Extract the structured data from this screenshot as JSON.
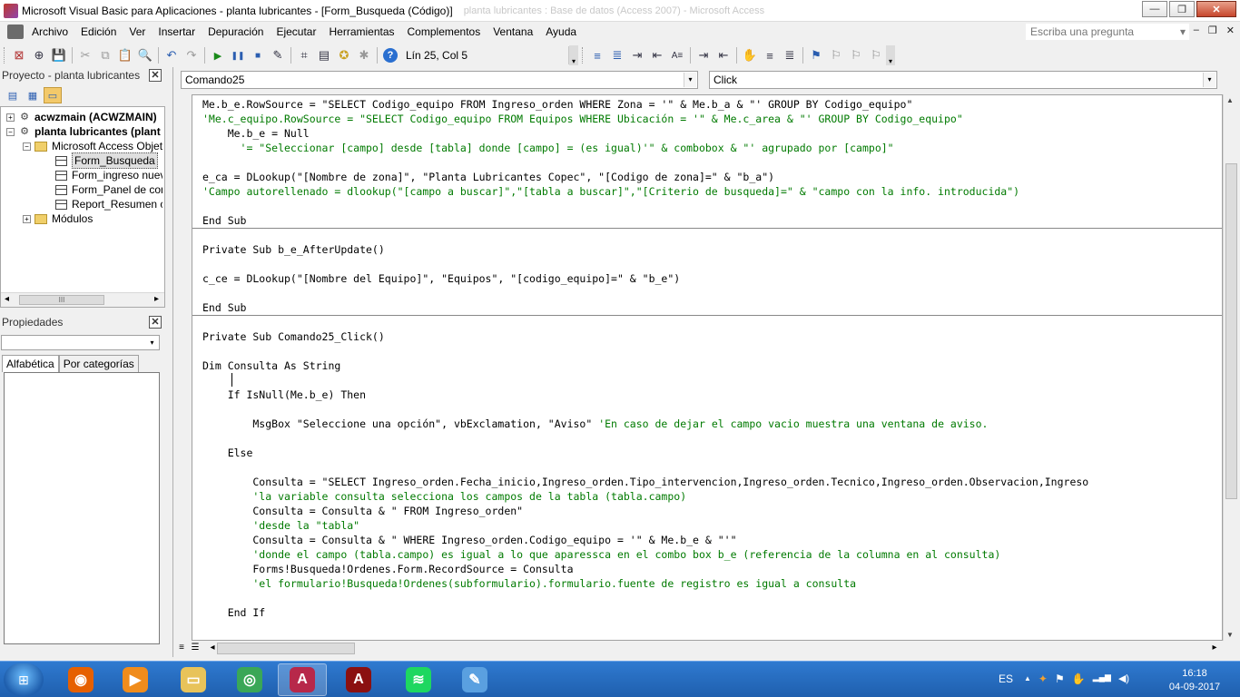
{
  "window": {
    "title": "Microsoft Visual Basic para Aplicaciones - planta lubricantes - [Form_Busqueda (Código)]",
    "ghost_title": "planta lubricantes : Base de datos (Access 2007) - Microsoft Access",
    "minimize_glyph": "—",
    "maximize_glyph": "❐",
    "close_glyph": "✕"
  },
  "menu": {
    "items": [
      "Archivo",
      "Edición",
      "Ver",
      "Insertar",
      "Depuración",
      "Ejecutar",
      "Herramientas",
      "Complementos",
      "Ventana",
      "Ayuda"
    ],
    "help_placeholder": "Escriba una pregunta",
    "help_dropdown_glyph": "▾",
    "mdi_minimize_glyph": "–",
    "mdi_restore_glyph": "❐",
    "mdi_close_glyph": "✕"
  },
  "toolbar": {
    "position_text": "Lín 25, Col 5",
    "icons": {
      "view_access": "⊠",
      "insert": "⊕",
      "save": "💾",
      "cut": "✂",
      "copy": "⧉",
      "paste": "📋",
      "find": "🔍",
      "undo": "↶",
      "redo": "↷",
      "run": "▶",
      "pause": "❚❚",
      "stop": "■",
      "design": "✎",
      "project": "⌗",
      "properties": "▤",
      "browser": "✪",
      "toolbox": "✱",
      "help": "?",
      "indent": "⇥",
      "outdent": "⇤",
      "toggle_bp": "●",
      "comment": "⁄",
      "uncomment": "⁄",
      "hand": "✋",
      "list": "≡",
      "quick": "≣",
      "bookmark": "⚑",
      "next_bm": "⚐",
      "prev_bm": "⚐",
      "clear_bm": "⚐",
      "chevron": "▾"
    }
  },
  "project_panel": {
    "title": "Proyecto - planta lubricantes",
    "close_glyph": "✕",
    "tools": {
      "view_code": "▤",
      "view_object": "▦",
      "toggle_folders": "▭"
    },
    "tree": [
      {
        "label": "acwzmain (ACWZMAIN)",
        "expander": "+",
        "bold": true
      },
      {
        "label": "planta lubricantes (plant",
        "expander": "−",
        "bold": true
      },
      {
        "label": "Microsoft Access Objetos",
        "expander": "−",
        "bold": false
      },
      {
        "label": "Form_Busqueda",
        "selected": true
      },
      {
        "label": "Form_ingreso nuevo"
      },
      {
        "label": "Form_Panel de contr"
      },
      {
        "label": "Report_Resumen co"
      },
      {
        "label": "Módulos",
        "expander": "+"
      }
    ],
    "scroll_left": "◂",
    "scroll_right": "▸",
    "scroll_grip": "III"
  },
  "properties_panel": {
    "title": "Propiedades",
    "close_glyph": "✕",
    "select_arrow": "▾",
    "tabs": [
      "Alfabética",
      "Por categorías"
    ]
  },
  "code_window": {
    "object_combo": "Comando25",
    "procedure_combo": "Click",
    "combo_arrow": "▾",
    "lines": [
      {
        "text": "Me.b_e.RowSource = \"SELECT Codigo_equipo FROM Ingreso_orden WHERE Zona = '\" & Me.b_a & \"' GROUP BY Codigo_equipo\"",
        "type": "code"
      },
      {
        "text": "'Me.c_equipo.RowSource = \"SELECT Codigo_equipo FROM Equipos WHERE Ubicación = '\" & Me.c_area & \"' GROUP BY Codigo_equipo\"",
        "type": "comment"
      },
      {
        "text": "    Me.b_e = Null",
        "type": "code"
      },
      {
        "text": "      '= \"Seleccionar [campo] desde [tabla] donde [campo] = (es igual)'\" & combobox & \"' agrupado por [campo]\"",
        "type": "comment"
      },
      {
        "text": "",
        "type": "code"
      },
      {
        "text": "e_ca = DLookup(\"[Nombre de zona]\", \"Planta Lubricantes Copec\", \"[Codigo de zona]=\" & \"b_a\")",
        "type": "code"
      },
      {
        "text": "'Campo autorellenado = dlookup(\"[campo a buscar]\",\"[tabla a buscar]\",\"[Criterio de busqueda]=\" & \"campo con la info. introducida\")",
        "type": "comment"
      },
      {
        "text": "",
        "type": "code"
      },
      {
        "text": "End Sub",
        "type": "code"
      },
      {
        "text": "",
        "type": "code"
      },
      {
        "text": "Private Sub b_e_AfterUpdate()",
        "type": "code"
      },
      {
        "text": "",
        "type": "code"
      },
      {
        "text": "c_ce = DLookup(\"[Nombre del Equipo]\", \"Equipos\", \"[codigo_equipo]=\" & \"b_e\")",
        "type": "code"
      },
      {
        "text": "",
        "type": "code"
      },
      {
        "text": "End Sub",
        "type": "code"
      },
      {
        "text": "",
        "type": "code"
      },
      {
        "text": "Private Sub Comando25_Click()",
        "type": "code"
      },
      {
        "text": "",
        "type": "code"
      },
      {
        "text": "Dim Consulta As String",
        "type": "code"
      },
      {
        "text": "",
        "type": "code"
      },
      {
        "text": "    If IsNull(Me.b_e) Then",
        "type": "code"
      },
      {
        "text": "",
        "type": "code"
      },
      {
        "text": "        MsgBox \"Seleccione una opción\", vbExclamation, \"Aviso\"",
        "type": "code",
        "trailing_comment": " 'En caso de dejar el campo vacio muestra una ventana de aviso."
      },
      {
        "text": "",
        "type": "code"
      },
      {
        "text": "    Else",
        "type": "code"
      },
      {
        "text": "",
        "type": "code"
      },
      {
        "text": "        Consulta = \"SELECT Ingreso_orden.Fecha_inicio,Ingreso_orden.Tipo_intervencion,Ingreso_orden.Tecnico,Ingreso_orden.Observacion,Ingreso",
        "type": "code"
      },
      {
        "text": "        'la variable consulta selecciona los campos de la tabla (tabla.campo)",
        "type": "comment"
      },
      {
        "text": "        Consulta = Consulta & \" FROM Ingreso_orden\"",
        "type": "code"
      },
      {
        "text": "        'desde la \"tabla\"",
        "type": "comment"
      },
      {
        "text": "        Consulta = Consulta & \" WHERE Ingreso_orden.Codigo_equipo = '\" & Me.b_e & \"'\"",
        "type": "code"
      },
      {
        "text": "        'donde el campo (tabla.campo) es igual a lo que aparessca en el combo box b_e (referencia de la columna en al consulta)",
        "type": "comment"
      },
      {
        "text": "        Forms!Busqueda!Ordenes.Form.RecordSource = Consulta",
        "type": "code"
      },
      {
        "text": "        'el formulario!Busqueda!Ordenes(subformulario).formulario.fuente de registro es igual a consulta",
        "type": "comment"
      },
      {
        "text": "",
        "type": "code"
      },
      {
        "text": "    End If",
        "type": "code"
      }
    ],
    "scroll_up": "▲",
    "scroll_down": "▼",
    "scroll_left": "◂",
    "scroll_right": "▸",
    "procedure_view_glyph": "≡",
    "full_module_view_glyph": "☰"
  },
  "taskbar": {
    "start_glyph": "⊞",
    "apps": [
      {
        "name": "firefox",
        "glyph": "◉",
        "color": "#e66000"
      },
      {
        "name": "media-player",
        "glyph": "▶",
        "color": "#f08c1c"
      },
      {
        "name": "file-explorer",
        "glyph": "▭",
        "color": "#e8c35a"
      },
      {
        "name": "chrome",
        "glyph": "◎",
        "color": "#3aa757"
      },
      {
        "name": "access",
        "glyph": "A",
        "color": "#b7284a"
      },
      {
        "name": "pdf-reader",
        "glyph": "A",
        "color": "#8b1010"
      },
      {
        "name": "spotify",
        "glyph": "≋",
        "color": "#1ed760"
      },
      {
        "name": "paint",
        "glyph": "✎",
        "color": "#5aa0e0"
      }
    ],
    "language": "ES",
    "tray_glyphs": {
      "show_hidden": "▲",
      "network": "▂▄▆",
      "volume": "◀)"
    },
    "time": "16:18",
    "date": "04-09-2017"
  }
}
